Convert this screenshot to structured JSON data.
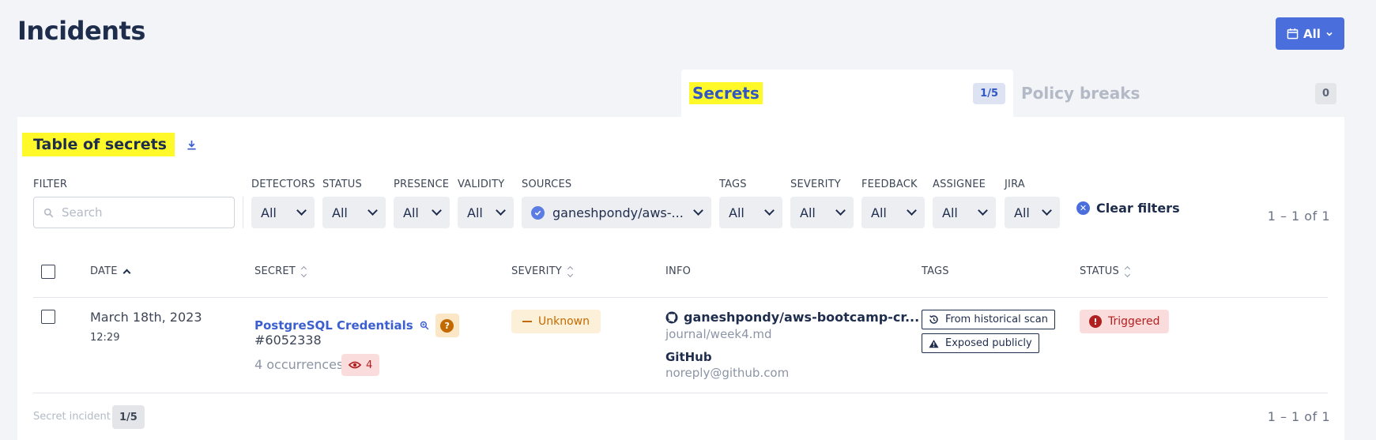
{
  "page": {
    "title": "Incidents"
  },
  "date_range": {
    "label": "All"
  },
  "tabs": [
    {
      "label": "Secrets",
      "count": "1/5",
      "active": true
    },
    {
      "label": "Policy breaks",
      "count": "0",
      "active": false
    }
  ],
  "table_title": "Table of secrets",
  "filters": {
    "filter_label": "FILTER",
    "search_placeholder": "Search",
    "search_value": "",
    "items": [
      {
        "label": "DETECTORS",
        "value": "All"
      },
      {
        "label": "STATUS",
        "value": "All"
      },
      {
        "label": "PRESENCE",
        "value": "All"
      },
      {
        "label": "VALIDITY",
        "value": "All"
      },
      {
        "label": "SOURCES",
        "value": "ganeshpondy/aws-..."
      },
      {
        "label": "TAGS",
        "value": "All"
      },
      {
        "label": "SEVERITY",
        "value": "All"
      },
      {
        "label": "FEEDBACK",
        "value": "All"
      },
      {
        "label": "ASSIGNEE",
        "value": "All"
      },
      {
        "label": "JIRA",
        "value": "All"
      }
    ],
    "clear_label": "Clear filters"
  },
  "pagination": {
    "text": "1 – 1  of  1"
  },
  "columns": {
    "date": "DATE",
    "secret": "SECRET",
    "severity": "SEVERITY",
    "info": "INFO",
    "tags": "TAGS",
    "status": "STATUS"
  },
  "rows": [
    {
      "date": "March 18th, 2023",
      "time": "12:29",
      "secret_name": "PostgreSQL Credentials",
      "secret_id": "#6052338",
      "occurrences": "4 occurrences",
      "views": "4",
      "severity": "Unknown",
      "repo": "ganeshpondy/aws-bootcamp-cr...",
      "path": "journal/week4.md",
      "author": "GitHub",
      "email": "noreply@github.com",
      "tags": [
        "From historical scan",
        "Exposed publicly"
      ],
      "status": "Triggered"
    }
  ],
  "footer": {
    "label": "Secret incident",
    "count": "1/5"
  },
  "colors": {
    "accent": "#4a6fdc",
    "highlight": "#fff92a",
    "danger": "#b21f1f",
    "warning": "#c26a00"
  }
}
